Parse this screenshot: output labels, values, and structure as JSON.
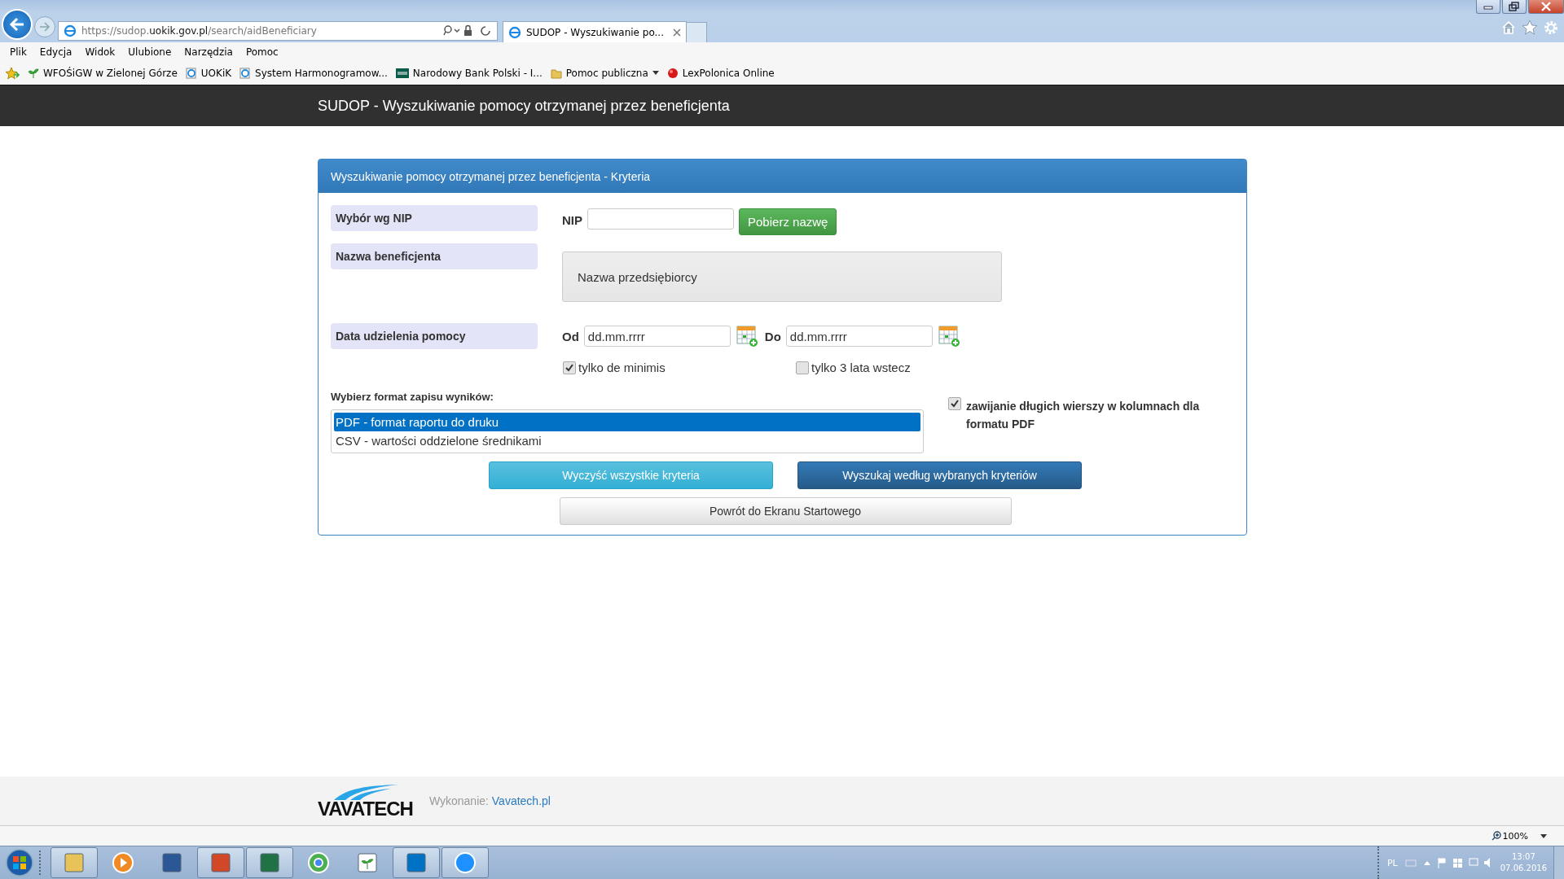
{
  "browser": {
    "address": "https://sudop.**uokik.gov.pl**/search/aidBeneficiary",
    "tabs": [
      {
        "title": "SUDOP - Wyszukiwanie po...",
        "selected": true
      }
    ],
    "menu": [
      "Plik",
      "Edycja",
      "Widok",
      "Ulubione",
      "Narzędzia",
      "Pomoc"
    ],
    "favorites": [
      {
        "label": "WFOŚiGW w Zielonej Górze",
        "kind": "leaf"
      },
      {
        "label": "UOKiK",
        "kind": "page"
      },
      {
        "label": "System Harmonogramow...",
        "kind": "page"
      },
      {
        "label": "Narodowy Bank Polski - I...",
        "kind": "bank"
      },
      {
        "label": "Pomoc publiczna",
        "kind": "folder"
      },
      {
        "label": "LexPolonica Online",
        "kind": "ball"
      }
    ],
    "zoom": "100%"
  },
  "site_title": "SUDOP - Wyszukiwanie pomocy otrzymanej przez beneficjenta",
  "panel": {
    "title": "Wyszukiwanie pomocy otrzymanej przez beneficjenta - Kryteria",
    "nip": {
      "section": "Wybór wg NIP",
      "label": "NIP",
      "button": "Pobierz nazwę"
    },
    "beneficiary": {
      "section": "Nazwa beneficjenta",
      "placeholder": "Nazwa przedsiębiorcy"
    },
    "dates": {
      "section": "Data udzielenia pomocy",
      "from_label": "Od",
      "from_placeholder": "dd.mm.rrrr",
      "to_label": "Do",
      "to_placeholder": "dd.mm.rrrr"
    },
    "checks": [
      {
        "label": "tylko de minimis",
        "checked": true
      },
      {
        "label": "tylko 3 lata wstecz",
        "checked": false
      }
    ],
    "format": {
      "label": "Wybierz format zapisu wyników:",
      "options": [
        {
          "label": "PDF - format raportu do druku",
          "selected": true
        },
        {
          "label": "CSV - wartości oddzielone średnikami",
          "selected": false
        }
      ]
    },
    "wrap": {
      "label": "zawijanie długich wierszy w kolumnach dla formatu PDF",
      "checked": true
    },
    "buttons": [
      {
        "label": "Wyczyść wszystkie kryteria",
        "kind": "info"
      },
      {
        "label": "Wyszukaj według wybranych kryteriów",
        "kind": "primary"
      },
      {
        "label": "Powrót do Ekranu Startowego",
        "kind": "default"
      }
    ]
  },
  "footer": {
    "logo": "VAVATECH",
    "credit": "Wykonanie: ",
    "link": "Vavatech.pl"
  },
  "taskbar": {
    "apps": [
      {
        "kind": "folder",
        "running": true
      },
      {
        "kind": "media",
        "running": false
      },
      {
        "kind": "word",
        "running": false
      },
      {
        "kind": "powerpoint",
        "running": true
      },
      {
        "kind": "excel",
        "running": true
      },
      {
        "kind": "chrome",
        "running": false
      },
      {
        "kind": "plant",
        "running": false
      },
      {
        "kind": "outlook",
        "running": true
      },
      {
        "kind": "ie",
        "running": true
      }
    ],
    "language": "PL",
    "time": "13:07",
    "date": "07.06.2016"
  }
}
